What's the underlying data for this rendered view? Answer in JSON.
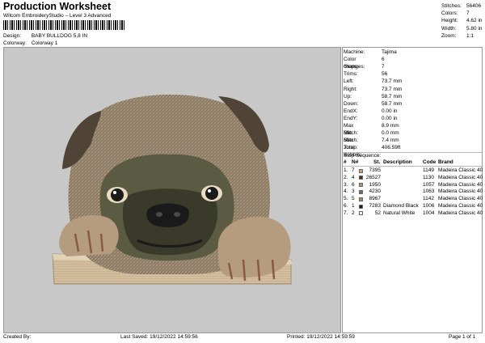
{
  "header": {
    "title": "Production Worksheet",
    "subtitle": "Wilcom EmbroideryStudio – Level 3 Advanced",
    "design_label": "Design:",
    "design_value": "BABY BULLDOG 5,8 IN",
    "colorway_label": "Colorway:",
    "colorway_value": "Colorway 1"
  },
  "stats": [
    {
      "label": "Stitches:",
      "value": "56406"
    },
    {
      "label": "Colors:",
      "value": "7"
    },
    {
      "label": "Height:",
      "value": "4.62 in"
    },
    {
      "label": "Width:",
      "value": "5.80 in"
    },
    {
      "label": "Zoom:",
      "value": "1:1"
    }
  ],
  "properties": [
    {
      "label": "Machine:",
      "value": "Tajima"
    },
    {
      "label": "Color changes:",
      "value": "6"
    },
    {
      "label": "Stops:",
      "value": "7"
    },
    {
      "label": "Trims:",
      "value": "56"
    },
    {
      "label": "Left:",
      "value": "73.7 mm"
    },
    {
      "label": "Right:",
      "value": "73.7 mm"
    },
    {
      "label": "Up:",
      "value": "58.7 mm"
    },
    {
      "label": "Down:",
      "value": "58.7 mm"
    },
    {
      "label": "EndX:",
      "value": "0.00 in"
    },
    {
      "label": "EndY:",
      "value": "0.00 in"
    },
    {
      "label": "Max Stitch:",
      "value": "8.9 mm"
    },
    {
      "label": "Min Stitch:",
      "value": "0.0 mm"
    },
    {
      "label": "Max Jump:",
      "value": "7.4 mm"
    },
    {
      "label": "Total Bobbin:",
      "value": "406.59ft"
    }
  ],
  "stop_sequence": {
    "title": "Stop Sequence:",
    "columns": [
      "#",
      "N#",
      "St.",
      "Description",
      "Code",
      "Brand"
    ],
    "rows": [
      {
        "idx": "1.",
        "n": "7",
        "color": "#c9a27f",
        "st": "7395",
        "desc": "",
        "code": "1149",
        "brand": "Madeira Classic 40"
      },
      {
        "idx": "2.",
        "n": "4",
        "color": "#4a2b22",
        "st": "26527",
        "desc": "",
        "code": "1130",
        "brand": "Madeira Classic 40"
      },
      {
        "idx": "3.",
        "n": "6",
        "color": "#b98f6a",
        "st": "1950",
        "desc": "",
        "code": "1057",
        "brand": "Madeira Classic 40"
      },
      {
        "idx": "4.",
        "n": "3",
        "color": "#7a6a52",
        "st": "4230",
        "desc": "",
        "code": "1063",
        "brand": "Madeira Classic 40"
      },
      {
        "idx": "5.",
        "n": "5",
        "color": "#a88766",
        "st": "8967",
        "desc": "",
        "code": "1142",
        "brand": "Madeira Classic 40"
      },
      {
        "idx": "6.",
        "n": "1",
        "color": "#1a1a1a",
        "st": "7283",
        "desc": "Diamond Black",
        "code": "1006",
        "brand": "Madeira Classic 40"
      },
      {
        "idx": "7.",
        "n": "2",
        "color": "#f5f5f5",
        "st": "52",
        "desc": "Natural White",
        "code": "1004",
        "brand": "Madeira Classic 40"
      }
    ]
  },
  "footer": {
    "created_by": "Created By:",
    "last_saved": "Last Saved: 19/12/2022 14:59:56",
    "printed": "Printed: 19/12/2022 14:59:59",
    "page": "Page 1 of 1"
  },
  "colors": {
    "canvas": "#c8c8c8",
    "fur": "#9c8a72",
    "dark_fur": "#4f4436",
    "mask": "#3a3a2a",
    "paw": "#b59c7e",
    "board": "#cdb89a"
  }
}
